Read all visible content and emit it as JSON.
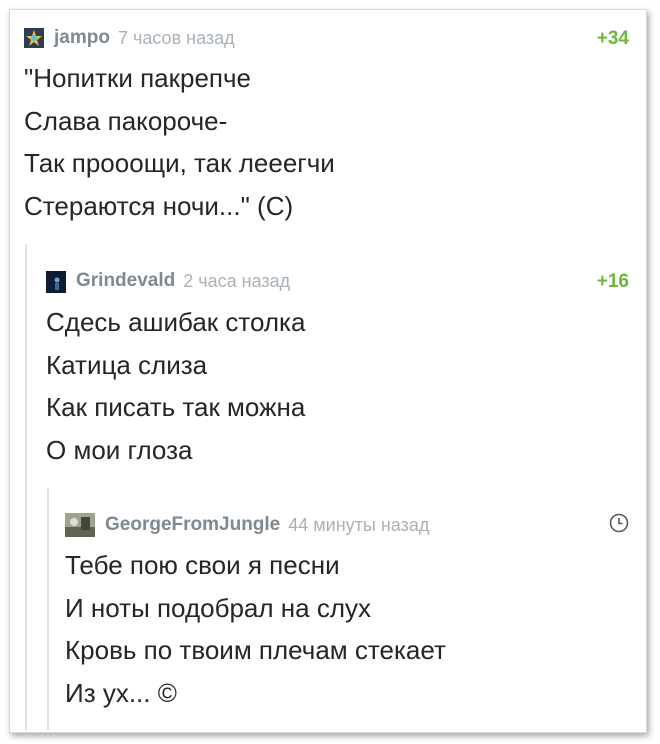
{
  "comments": [
    {
      "author": "jampo",
      "time": "7 часов назад",
      "rating": "+34",
      "lines": [
        "\"Нопитки пакрепче",
        "Слава пакороче-",
        "Так прооощи, так лееегчи",
        "Стераются ночи...\" (С)"
      ]
    },
    {
      "author": "Grindevald",
      "time": "2 часа назад",
      "rating": "+16",
      "lines": [
        "Сдесь ашибак столка",
        "Катица слиза",
        "Как писать так можна",
        "О мои глоза"
      ]
    },
    {
      "author": "GeorgeFromJungle",
      "time": "44 минуты назад",
      "lines": [
        "Тебе пою свои я песни",
        "И ноты подобрал на слух",
        "Кровь по твоим плечам стекает",
        "Из ух... ©"
      ]
    }
  ],
  "colors": {
    "rating": "#6cb83c",
    "author": "#7d8a92",
    "time": "#a8b2b8",
    "text": "#262626",
    "thread_line": "#e2e2e2"
  },
  "icons": {
    "pending_rating": "clock-icon"
  }
}
